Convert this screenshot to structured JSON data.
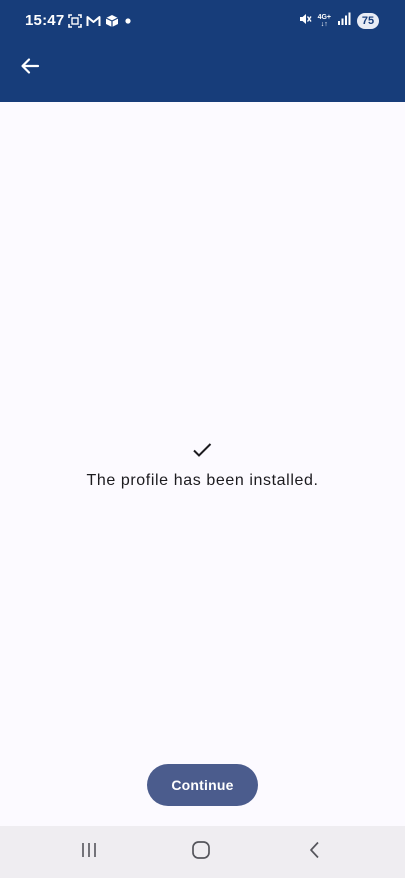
{
  "status_bar": {
    "time": "15:47",
    "left_icons": [
      "screenshot-icon",
      "gmail-icon",
      "app-icon",
      "notification-dot-icon"
    ],
    "network_label_top": "4G+",
    "network_label_bottom": "↓↑",
    "battery": "75",
    "right_icons": [
      "mute-icon",
      "network-4g-icon",
      "signal-icon",
      "battery-icon"
    ]
  },
  "app_bar": {
    "back_icon": "arrow-left-icon"
  },
  "main": {
    "status_icon": "check-icon",
    "message": "The profile has been installed.",
    "continue_label": "Continue"
  },
  "nav_bar": {
    "items": [
      "recents-icon",
      "home-icon",
      "back-icon"
    ]
  },
  "colors": {
    "header": "#173d7a",
    "background": "#fcfaff",
    "button": "#4b5c8d",
    "nav_bar": "#efedf1"
  }
}
